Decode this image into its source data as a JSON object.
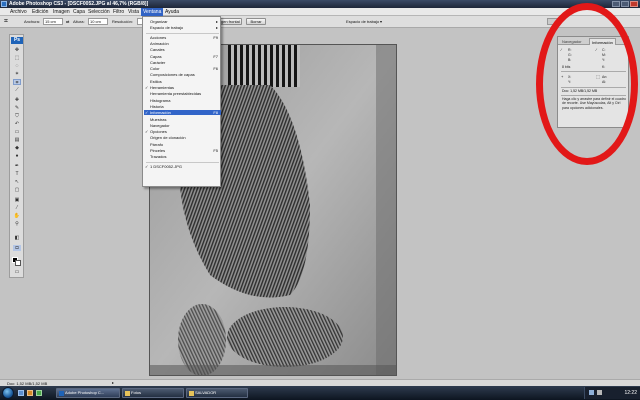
{
  "window": {
    "title": "Adobe Photoshop CS3 - [DSCF0052.JPG al 46,7% (RGB/8)]"
  },
  "menubar": {
    "items": [
      "Archivo",
      "Edición",
      "Imagen",
      "Capa",
      "Selección",
      "Filtro",
      "Vista",
      "Ventana",
      "Ayuda"
    ],
    "active": "Ventana"
  },
  "options_bar": {
    "anchura_label": "Anchura:",
    "anchura_value": "15 cm",
    "altura_label": "Altura:",
    "altura_value": "10 cm",
    "resolucion_label": "Resolución:",
    "imagen_frontal_button": "Imagen frontal",
    "borrar_button": "Borrar",
    "workspace_label": "Espacio de trabajo"
  },
  "window_menu": {
    "items": [
      {
        "label": "Organizar",
        "check": false,
        "shortcut": "",
        "submenu": true
      },
      {
        "label": "Espacio de trabajo",
        "check": false,
        "shortcut": "",
        "submenu": true
      },
      {
        "sep": true
      },
      {
        "label": "Acciones",
        "check": false,
        "shortcut": "F9"
      },
      {
        "label": "Animación",
        "check": false,
        "shortcut": ""
      },
      {
        "label": "Canales",
        "check": false,
        "shortcut": ""
      },
      {
        "label": "Capas",
        "check": false,
        "shortcut": "F7"
      },
      {
        "label": "Carácter",
        "check": false,
        "shortcut": ""
      },
      {
        "label": "Color",
        "check": false,
        "shortcut": "F6"
      },
      {
        "label": "Composiciones de capas",
        "check": false,
        "shortcut": ""
      },
      {
        "label": "Estilos",
        "check": false,
        "shortcut": ""
      },
      {
        "label": "Herramientas",
        "check": true,
        "shortcut": ""
      },
      {
        "label": "Herramienta preestablecidas",
        "check": false,
        "shortcut": ""
      },
      {
        "label": "Histograma",
        "check": false,
        "shortcut": ""
      },
      {
        "label": "Historia",
        "check": false,
        "shortcut": ""
      },
      {
        "label": "Información",
        "check": true,
        "shortcut": "F8",
        "highlight": true
      },
      {
        "label": "Muestras",
        "check": false,
        "shortcut": ""
      },
      {
        "label": "Navegador",
        "check": false,
        "shortcut": ""
      },
      {
        "label": "Opciones",
        "check": true,
        "shortcut": ""
      },
      {
        "label": "Origen de clonación",
        "check": false,
        "shortcut": ""
      },
      {
        "label": "Párrafo",
        "check": false,
        "shortcut": ""
      },
      {
        "label": "Pinceles",
        "check": false,
        "shortcut": "F5"
      },
      {
        "label": "Trazados",
        "check": false,
        "shortcut": ""
      },
      {
        "sep": true
      },
      {
        "label": "1 DSCF0052.JPG",
        "check": true,
        "shortcut": ""
      }
    ]
  },
  "info_panel": {
    "tabs": [
      "Navegador",
      "Información"
    ],
    "active_tab": "Información",
    "cells": [
      {
        "name": "R:",
        "value": ""
      },
      {
        "name": "C:",
        "value": ""
      },
      {
        "name": "G:",
        "value": ""
      },
      {
        "name": "M:",
        "value": ""
      },
      {
        "name": "B:",
        "value": ""
      },
      {
        "name": "Y:",
        "value": ""
      },
      {
        "name": "8 bits",
        "value": ""
      },
      {
        "name": "K:",
        "value": ""
      },
      {
        "name": "X:",
        "value": ""
      },
      {
        "name": "An:",
        "value": ""
      },
      {
        "name": "Y:",
        "value": ""
      },
      {
        "name": "Al:",
        "value": ""
      }
    ],
    "doc_line": "Doc: 1,52 MB/1,52 MB",
    "help_text": "Haga clic y arrastre para definir el cuadro de recorte. Use Mayúsculas, Alt y Ctrl para opciones adicionales."
  },
  "status_bar": {
    "doc_size": "Doc: 1,52 MB/1,52 MB"
  },
  "taskbar": {
    "buttons": [
      {
        "label": "Adobe Photoshop C...",
        "icon": "photoshop-icon"
      },
      {
        "label": "Fotos",
        "icon": "folder-icon"
      },
      {
        "label": "SALVADOR",
        "icon": "folder-icon"
      }
    ],
    "clock": "12:22"
  },
  "colors": {
    "menu_highlight": "#3164c8",
    "annotation_red": "#e21818",
    "photoshop_blue": "#1e63b8"
  }
}
